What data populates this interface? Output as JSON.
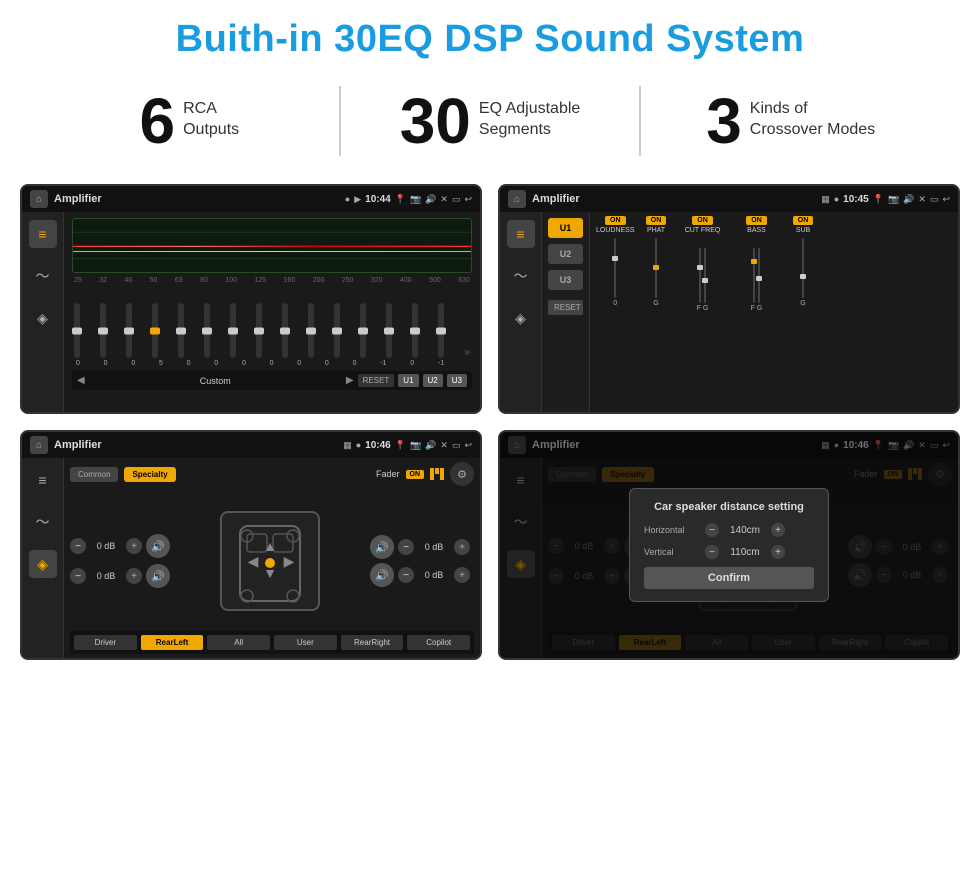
{
  "header": {
    "title": "Buith-in 30EQ DSP Sound System"
  },
  "stats": [
    {
      "number": "6",
      "label": "RCA\nOutputs"
    },
    {
      "number": "30",
      "label": "EQ Adjustable\nSegments"
    },
    {
      "number": "3",
      "label": "Kinds of\nCrossover Modes"
    }
  ],
  "screens": [
    {
      "id": "screen-eq",
      "statusBar": {
        "title": "Amplifier",
        "time": "10:44"
      },
      "type": "eq"
    },
    {
      "id": "screen-amp",
      "statusBar": {
        "title": "Amplifier",
        "time": "10:45"
      },
      "type": "amp"
    },
    {
      "id": "screen-crossover",
      "statusBar": {
        "title": "Amplifier",
        "time": "10:46"
      },
      "type": "crossover"
    },
    {
      "id": "screen-dialog",
      "statusBar": {
        "title": "Amplifier",
        "time": "10:46"
      },
      "type": "dialog"
    }
  ],
  "eq": {
    "frequencies": [
      "25",
      "32",
      "40",
      "50",
      "63",
      "80",
      "100",
      "125",
      "160",
      "200",
      "250",
      "320",
      "400",
      "500",
      "630"
    ],
    "values": [
      "0",
      "0",
      "0",
      "5",
      "0",
      "0",
      "0",
      "0",
      "0",
      "0",
      "0",
      "-1",
      "0",
      "-1",
      ""
    ],
    "presets": [
      "Custom",
      "RESET",
      "U1",
      "U2",
      "U3"
    ]
  },
  "amp": {
    "presets": [
      "U1",
      "U2",
      "U3"
    ],
    "columns": [
      {
        "label": "LOUDNESS",
        "on": true
      },
      {
        "label": "PHAT",
        "on": true
      },
      {
        "label": "CUT FREQ",
        "on": true
      },
      {
        "label": "BASS",
        "on": true
      },
      {
        "label": "SUB",
        "on": true
      }
    ]
  },
  "crossover": {
    "tabs": [
      "Common",
      "Specialty"
    ],
    "fader": "Fader",
    "faderOn": "ON",
    "dbValues": [
      "0 dB",
      "0 dB",
      "0 dB",
      "0 dB"
    ],
    "buttons": [
      "Driver",
      "RearLeft",
      "All",
      "User",
      "RearRight",
      "Copilot"
    ]
  },
  "dialog": {
    "title": "Car speaker distance setting",
    "horizontal": {
      "label": "Horizontal",
      "value": "140cm"
    },
    "vertical": {
      "label": "Vertical",
      "value": "110cm"
    },
    "confirmLabel": "Confirm",
    "tabs": [
      "Common",
      "Specialty"
    ],
    "fader": "Fader",
    "faderOn": "ON",
    "dbValues": [
      "0 dB",
      "0 dB"
    ],
    "buttons": [
      "Driver",
      "RearLeft",
      "All",
      "User",
      "RearRight",
      "Copilot"
    ]
  }
}
